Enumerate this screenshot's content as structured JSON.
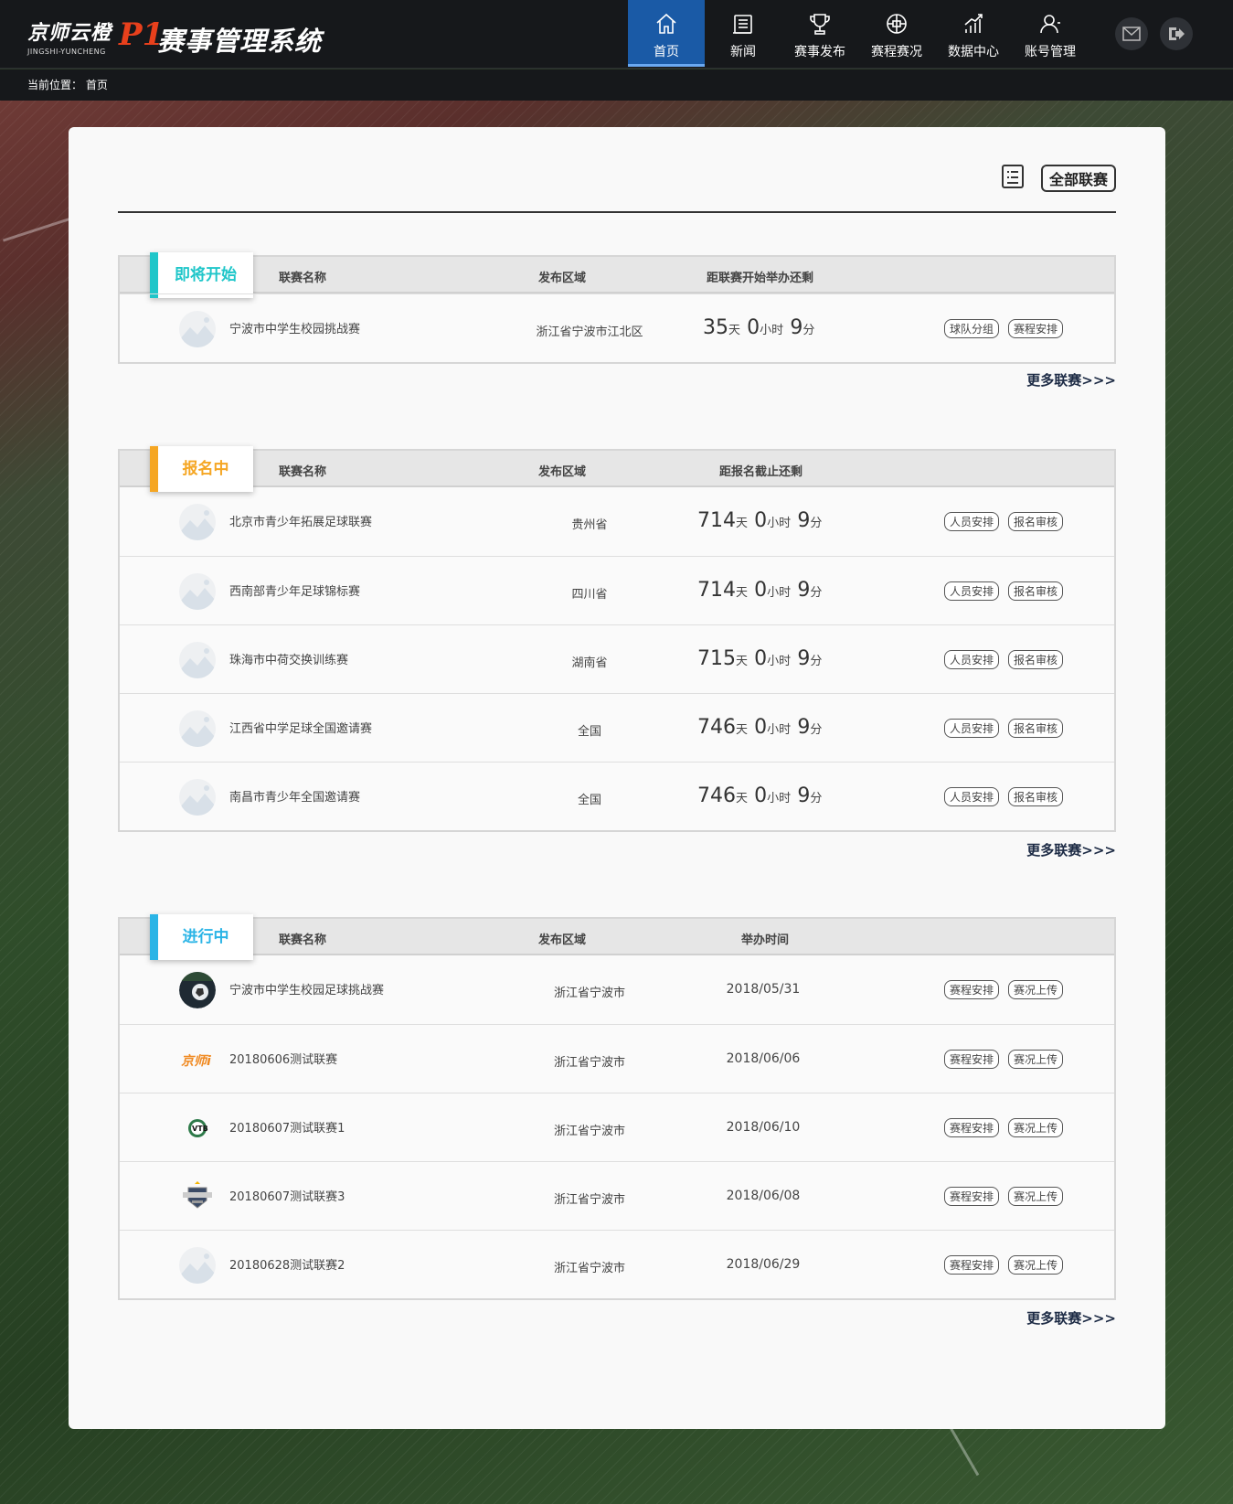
{
  "header": {
    "logo_brand": "京师云橙",
    "logo_sub": "JINGSHI-YUNCHENG",
    "logo_p1": "P1",
    "system_title": "赛事管理系统",
    "nav": [
      {
        "label": "首页",
        "icon": "home-icon"
      },
      {
        "label": "新闻",
        "icon": "news-icon"
      },
      {
        "label": "赛事发布",
        "icon": "trophy-icon"
      },
      {
        "label": "赛程赛况",
        "icon": "ball-icon"
      },
      {
        "label": "数据中心",
        "icon": "chart-icon"
      },
      {
        "label": "账号管理",
        "icon": "user-icon"
      }
    ]
  },
  "breadcrumb": {
    "label": "当前位置：",
    "current": "首页"
  },
  "toolbar": {
    "all_leagues": "全部联赛"
  },
  "colors": {
    "upcoming": "#1fc6c9",
    "signup": "#f5a623",
    "ongoing": "#2ab4e6",
    "nav_active": "#1a5aa6"
  },
  "sections": {
    "upcoming": {
      "tag": "即将开始",
      "col_name": "联赛名称",
      "col_region": "发布区域",
      "col_time": "距联赛开始举办还剩",
      "more": "更多联赛>>>",
      "rows": [
        {
          "name": "宁波市中学生校园挑战赛",
          "region": "浙江省宁波市江北区",
          "days": "35",
          "d": "天",
          "hours": "0",
          "h": "小时",
          "mins": "9",
          "m": "分",
          "btn1": "球队分组",
          "btn2": "赛程安排"
        }
      ]
    },
    "signup": {
      "tag": "报名中",
      "col_name": "联赛名称",
      "col_region": "发布区域",
      "col_time": "距报名截止还剩",
      "more": "更多联赛>>>",
      "rows": [
        {
          "name": "北京市青少年拓展足球联赛",
          "region": "贵州省",
          "days": "714",
          "d": "天",
          "hours": "0",
          "h": "小时",
          "mins": "9",
          "m": "分",
          "btn1": "人员安排",
          "btn2": "报名审核"
        },
        {
          "name": "西南部青少年足球锦标赛",
          "region": "四川省",
          "days": "714",
          "d": "天",
          "hours": "0",
          "h": "小时",
          "mins": "9",
          "m": "分",
          "btn1": "人员安排",
          "btn2": "报名审核"
        },
        {
          "name": "珠海市中荷交换训练赛",
          "region": "湖南省",
          "days": "715",
          "d": "天",
          "hours": "0",
          "h": "小时",
          "mins": "9",
          "m": "分",
          "btn1": "人员安排",
          "btn2": "报名审核"
        },
        {
          "name": "江西省中学足球全国邀请赛",
          "region": "全国",
          "days": "746",
          "d": "天",
          "hours": "0",
          "h": "小时",
          "mins": "9",
          "m": "分",
          "btn1": "人员安排",
          "btn2": "报名审核"
        },
        {
          "name": "南昌市青少年全国邀请赛",
          "region": "全国",
          "days": "746",
          "d": "天",
          "hours": "0",
          "h": "小时",
          "mins": "9",
          "m": "分",
          "btn1": "人员安排",
          "btn2": "报名审核"
        }
      ]
    },
    "ongoing": {
      "tag": "进行中",
      "col_name": "联赛名称",
      "col_region": "发布区域",
      "col_time": "举办时间",
      "more": "更多联赛>>>",
      "rows": [
        {
          "name": "宁波市中学生校园足球挑战赛",
          "region": "浙江省宁波市",
          "date": "2018/05/31",
          "btn1": "赛程安排",
          "btn2": "赛况上传",
          "logo": "soccer-photo"
        },
        {
          "name": "20180606测试联赛",
          "region": "浙江省宁波市",
          "date": "2018/06/06",
          "btn1": "赛程安排",
          "btn2": "赛况上传",
          "logo": "jingshi-logo",
          "logo_text": "京师i"
        },
        {
          "name": "20180607测试联赛1",
          "region": "浙江省宁波市",
          "date": "2018/06/10",
          "btn1": "赛程安排",
          "btn2": "赛况上传",
          "logo": "vtb-badge",
          "logo_text": "VTB"
        },
        {
          "name": "20180607测试联赛3",
          "region": "浙江省宁波市",
          "date": "2018/06/08",
          "btn1": "赛程安排",
          "btn2": "赛况上传",
          "logo": "crest-badge"
        },
        {
          "name": "20180628测试联赛2",
          "region": "浙江省宁波市",
          "date": "2018/06/29",
          "btn1": "赛程安排",
          "btn2": "赛况上传",
          "logo": "placeholder"
        }
      ]
    }
  }
}
